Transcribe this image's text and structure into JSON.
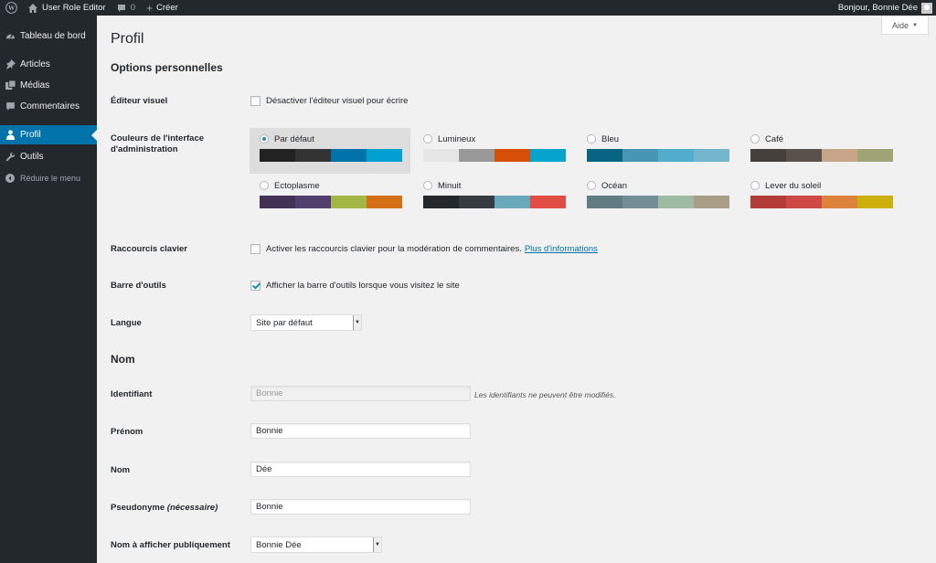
{
  "adminbar": {
    "site_name": "User Role Editor",
    "comments_count": "0",
    "new_label": "Créer",
    "greeting": "Bonjour, Bonnie Dée"
  },
  "sidebar": {
    "items": [
      {
        "label": "Tableau de bord",
        "icon": "dashboard-icon"
      },
      {
        "label": "Articles",
        "icon": "pin-icon"
      },
      {
        "label": "Médias",
        "icon": "media-icon"
      },
      {
        "label": "Commentaires",
        "icon": "comment-icon"
      },
      {
        "label": "Profil",
        "icon": "user-icon"
      },
      {
        "label": "Outils",
        "icon": "wrench-icon"
      }
    ],
    "collapse_label": "Réduire le menu",
    "accent_color": "#0073aa"
  },
  "help": {
    "label": "Aide"
  },
  "page": {
    "title": "Profil",
    "section_personal": "Options personnelles",
    "section_name": "Nom"
  },
  "visual_editor": {
    "label": "Éditeur visuel",
    "checkbox": "Désactiver l'éditeur visuel pour écrire",
    "checked": false
  },
  "admin_colors": {
    "label_line1": "Couleurs de l'interface",
    "label_line2": "d'administration",
    "schemes": [
      {
        "name": "Par défaut",
        "selected": true,
        "colors": [
          "#222222",
          "#333333",
          "#0073aa",
          "#00a0d2"
        ]
      },
      {
        "name": "Lumineux",
        "selected": false,
        "colors": [
          "#e5e5e5",
          "#999999",
          "#d64e07",
          "#04a4cc"
        ]
      },
      {
        "name": "Bleu",
        "selected": false,
        "colors": [
          "#096484",
          "#4796b3",
          "#52accc",
          "#74b6ce"
        ]
      },
      {
        "name": "Café",
        "selected": false,
        "colors": [
          "#46403c",
          "#59524c",
          "#c7a589",
          "#9ea476"
        ]
      },
      {
        "name": "Ectoplasme",
        "selected": false,
        "colors": [
          "#413256",
          "#523f6d",
          "#a3b745",
          "#d46f15"
        ]
      },
      {
        "name": "Minuit",
        "selected": false,
        "colors": [
          "#25282b",
          "#363b3f",
          "#69a8bb",
          "#e14d43"
        ]
      },
      {
        "name": "Océan",
        "selected": false,
        "colors": [
          "#627c83",
          "#738e96",
          "#9ebaa0",
          "#aa9d88"
        ]
      },
      {
        "name": "Lever du soleil",
        "selected": false,
        "colors": [
          "#b43c38",
          "#cf4944",
          "#dd823b",
          "#ccaf0b"
        ]
      }
    ]
  },
  "shortcuts": {
    "label": "Raccourcis clavier",
    "checkbox": "Activer les raccourcis clavier pour la modération de commentaires.",
    "link": "Plus d'informations",
    "checked": false
  },
  "toolbar": {
    "label": "Barre d'outils",
    "checkbox": "Afficher la barre d'outils lorsque vous visitez le site",
    "checked": true
  },
  "language": {
    "label": "Langue",
    "value": "Site par défaut"
  },
  "fields": {
    "username": {
      "label": "Identifiant",
      "value": "Bonnie",
      "note": "Les identifiants ne peuvent être modifiés."
    },
    "first_name": {
      "label": "Prénom",
      "value": "Bonnie"
    },
    "last_name": {
      "label": "Nom",
      "value": "Dée"
    },
    "nickname": {
      "label": "Pseudonyme",
      "required": "(nécessaire)",
      "value": "Bonnie"
    },
    "display_name": {
      "label": "Nom à afficher publiquement",
      "value": "Bonnie Dée"
    }
  }
}
